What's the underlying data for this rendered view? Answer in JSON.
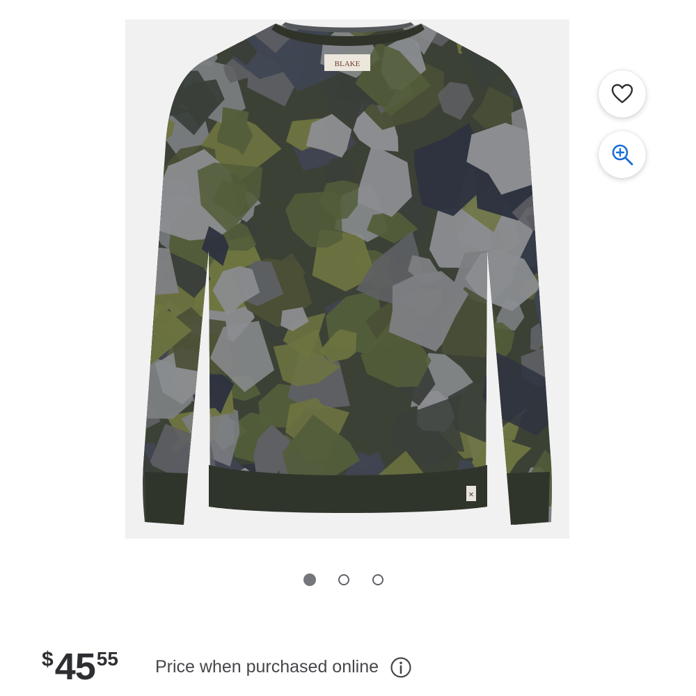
{
  "product": {
    "image_alt": "Camouflage crewneck sweatshirt",
    "label_text": "BLAKE",
    "camo_colors": [
      "#3a3f3a",
      "#535d3a",
      "#6e7440",
      "#5e6064",
      "#7d7f82",
      "#2e3340",
      "#404552",
      "#8b8d90",
      "#4a4f36"
    ]
  },
  "actions": {
    "favorite_icon": "heart-icon",
    "zoom_icon": "zoom-in-icon",
    "zoom_color": "#1a6fd6"
  },
  "carousel": {
    "count": 3,
    "active_index": 0
  },
  "price": {
    "currency": "$",
    "dollars": "45",
    "cents": "55",
    "note": "Price when purchased online",
    "info_icon": "info-icon"
  }
}
